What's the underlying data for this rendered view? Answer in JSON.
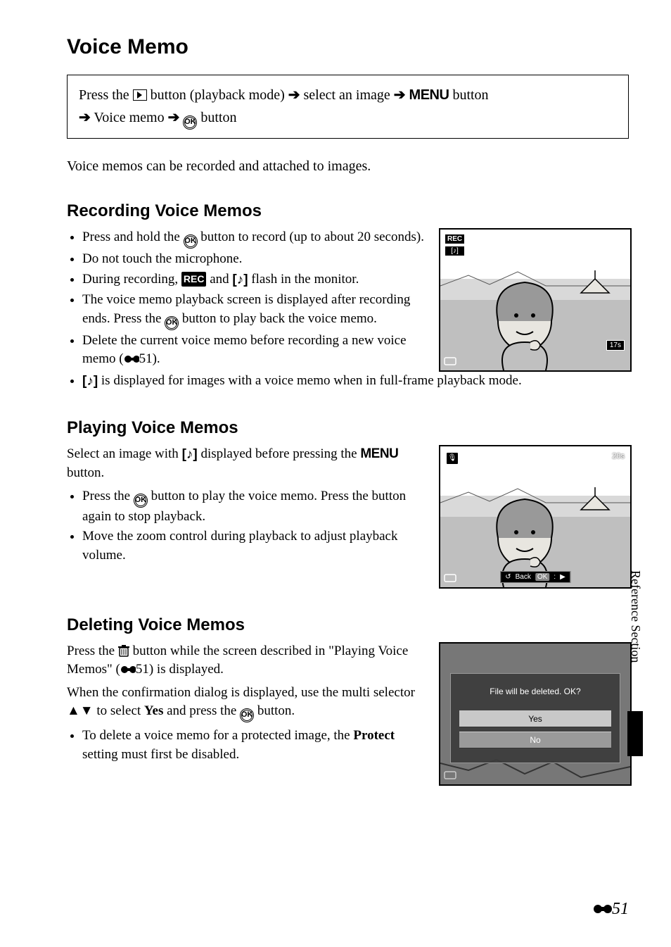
{
  "page_title": "Voice Memo",
  "nav": {
    "l1_a": "Press the ",
    "l1_b": " button (playback mode) ",
    "l1_c": " select an image ",
    "l1_d": " button",
    "l2_a": " Voice memo ",
    "l2_b": " button",
    "menu_label": "MENU"
  },
  "intro": "Voice memos can be recorded and attached to images.",
  "rec": {
    "heading": "Recording Voice Memos",
    "b1_a": "Press and hold the ",
    "b1_b": " button to record (up to about 20 seconds).",
    "b2": "Do not touch the microphone.",
    "b3_a": "During recording, ",
    "b3_b": " and ",
    "b3_c": " flash in the monitor.",
    "b4_a": "The voice memo playback screen is displayed after recording ends. Press the ",
    "b4_b": " button to play back the voice memo.",
    "b5_a": "Delete the current voice memo before recording a new voice memo (",
    "b5_b": "51).",
    "b6_a": " is displayed for images with a voice memo when in full-frame playback mode.",
    "rec_badge": "REC",
    "screen_timer": "17s"
  },
  "play": {
    "heading": "Playing Voice Memos",
    "p1_a": "Select an image with ",
    "p1_b": " displayed before pressing the ",
    "p1_c": " button.",
    "b1_a": "Press the ",
    "b1_b": " button to play the voice memo. Press the button again to stop playback.",
    "b2": "Move the zoom control during playback to adjust playback volume.",
    "screen_timer": "20s",
    "back_label": "Back",
    "ok_label": "OK"
  },
  "del": {
    "heading": "Deleting Voice Memos",
    "p1_a": "Press the ",
    "p1_b": " button while the screen described in \"Playing Voice Memos\" (",
    "p1_c": "51) is displayed.",
    "p2_a": "When the confirmation dialog is displayed, use the multi selector ",
    "p2_b": " to select ",
    "p2_yes": "Yes",
    "p2_c": " and press the ",
    "p2_d": " button.",
    "b1_a": "To delete a voice memo for a protected image, the ",
    "b1_protect": "Protect",
    "b1_b": " setting must first be disabled.",
    "dialog_title": "File will be deleted. OK?",
    "opt_yes": "Yes",
    "opt_no": "No"
  },
  "side_tab": "Reference Section",
  "page_number": "51",
  "glyphs": {
    "arrow": "➔",
    "ok": "OK",
    "speaker": "[♪]",
    "mic": "🎤",
    "up_down": "▲▼",
    "back_arrow": "↺",
    "play": "▶"
  }
}
